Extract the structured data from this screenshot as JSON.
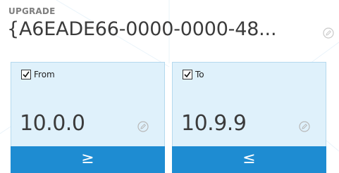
{
  "section_label": "UPGRADE",
  "product_code": "{A6EADE66-0000-0000-48...",
  "from_card": {
    "checkbox_checked": true,
    "label": "From",
    "version": "10.0.0",
    "operator": "≥"
  },
  "to_card": {
    "checkbox_checked": true,
    "label": "To",
    "version": "10.9.9",
    "operator": "≤"
  },
  "colors": {
    "card_bg": "#dff1fb",
    "card_border": "#b4d9ee",
    "button_bg": "#1e8cd2",
    "heading": "#7f7f7f",
    "text": "#3b3b3b"
  },
  "icons": {
    "edit": "pencil-circle-icon",
    "check": "checkmark-icon"
  }
}
